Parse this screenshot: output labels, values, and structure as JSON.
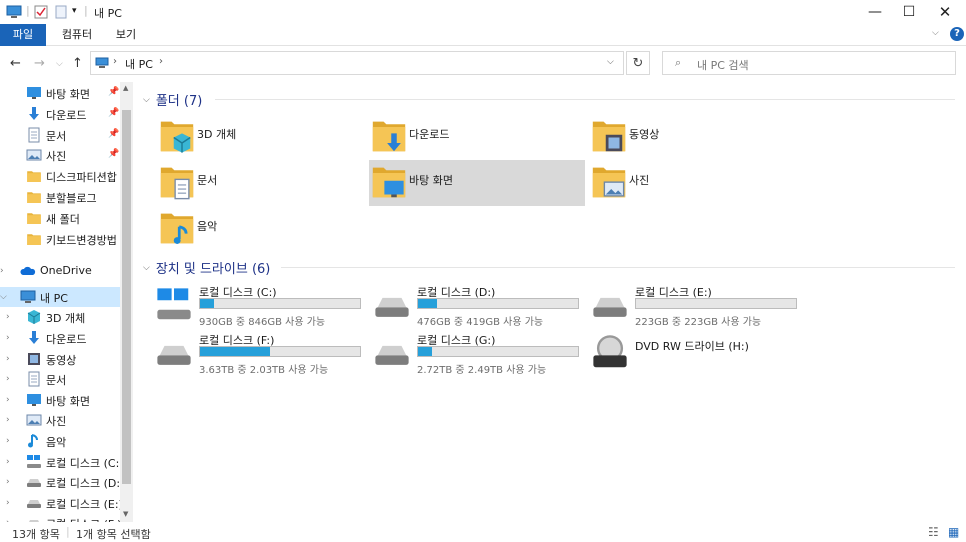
{
  "window": {
    "title": "내 PC"
  },
  "ribbon": {
    "tabs": [
      "파일",
      "컴퓨터",
      "보기"
    ]
  },
  "address": {
    "path": "내 PC",
    "search_placeholder": "내 PC 검색"
  },
  "nav": {
    "quick": [
      {
        "label": "바탕 화면",
        "icon": "desktop-icon",
        "pinned": true
      },
      {
        "label": "다운로드",
        "icon": "download-icon",
        "pinned": true
      },
      {
        "label": "문서",
        "icon": "document-icon",
        "pinned": true
      },
      {
        "label": "사진",
        "icon": "pictures-icon",
        "pinned": true
      },
      {
        "label": "디스크파티션합",
        "icon": "folder-icon",
        "pinned": false
      },
      {
        "label": "분할블로그",
        "icon": "folder-icon",
        "pinned": false
      },
      {
        "label": "새 폴더",
        "icon": "folder-icon",
        "pinned": false
      },
      {
        "label": "키보드변경방법",
        "icon": "folder-icon",
        "pinned": false
      }
    ],
    "onedrive": "OneDrive",
    "thispc": "내 PC",
    "pc_children": [
      {
        "label": "3D 개체",
        "icon": "3d-objects-icon"
      },
      {
        "label": "다운로드",
        "icon": "download-icon"
      },
      {
        "label": "동영상",
        "icon": "video-icon"
      },
      {
        "label": "문서",
        "icon": "document-icon"
      },
      {
        "label": "바탕 화면",
        "icon": "desktop-icon"
      },
      {
        "label": "사진",
        "icon": "pictures-icon"
      },
      {
        "label": "음악",
        "icon": "music-icon"
      },
      {
        "label": "로컬 디스크 (C:)",
        "icon": "windows-drive-icon"
      },
      {
        "label": "로컬 디스크 (D:)",
        "icon": "drive-icon"
      },
      {
        "label": "로컬 디스크 (E:)",
        "icon": "drive-icon"
      },
      {
        "label": "로컬 디스크 (F:)",
        "icon": "drive-icon"
      }
    ]
  },
  "folders": {
    "header": "폴더 (7)",
    "items": [
      {
        "label": "3D 개체",
        "icon": "3d-objects-icon",
        "selected": false
      },
      {
        "label": "다운로드",
        "icon": "download-icon",
        "selected": false
      },
      {
        "label": "동영상",
        "icon": "video-icon",
        "selected": false
      },
      {
        "label": "문서",
        "icon": "document-icon",
        "selected": false
      },
      {
        "label": "바탕 화면",
        "icon": "desktop-icon",
        "selected": true
      },
      {
        "label": "사진",
        "icon": "pictures-icon",
        "selected": false
      },
      {
        "label": "음악",
        "icon": "music-icon",
        "selected": false
      }
    ]
  },
  "drives": {
    "header": "장치 및 드라이브 (6)",
    "items": [
      {
        "label": "로컬 디스크 (C:)",
        "free": "930GB 중 846GB 사용 가능",
        "used_fraction": 0.09,
        "icon": "windows-drive-icon"
      },
      {
        "label": "로컬 디스크 (D:)",
        "free": "476GB 중 419GB 사용 가능",
        "used_fraction": 0.12,
        "icon": "drive-icon"
      },
      {
        "label": "로컬 디스크 (E:)",
        "free": "223GB 중 223GB 사용 가능",
        "used_fraction": 0.0,
        "icon": "drive-icon"
      },
      {
        "label": "로컬 디스크 (F:)",
        "free": "3.63TB 중 2.03TB 사용 가능",
        "used_fraction": 0.44,
        "icon": "drive-icon"
      },
      {
        "label": "로컬 디스크 (G:)",
        "free": "2.72TB 중 2.49TB 사용 가능",
        "used_fraction": 0.09,
        "icon": "drive-icon"
      },
      {
        "label": "DVD RW 드라이브 (H:)",
        "free": "",
        "used_fraction": null,
        "icon": "dvd-drive-icon"
      }
    ]
  },
  "status": {
    "count": "13개 항목",
    "selected": "1개 항목 선택함"
  },
  "colors": {
    "accent": "#1a64b8",
    "folder": "#f5c555",
    "bar": "#26a0da",
    "group_header": "#1e3287",
    "selection": "#d9d9d9"
  }
}
